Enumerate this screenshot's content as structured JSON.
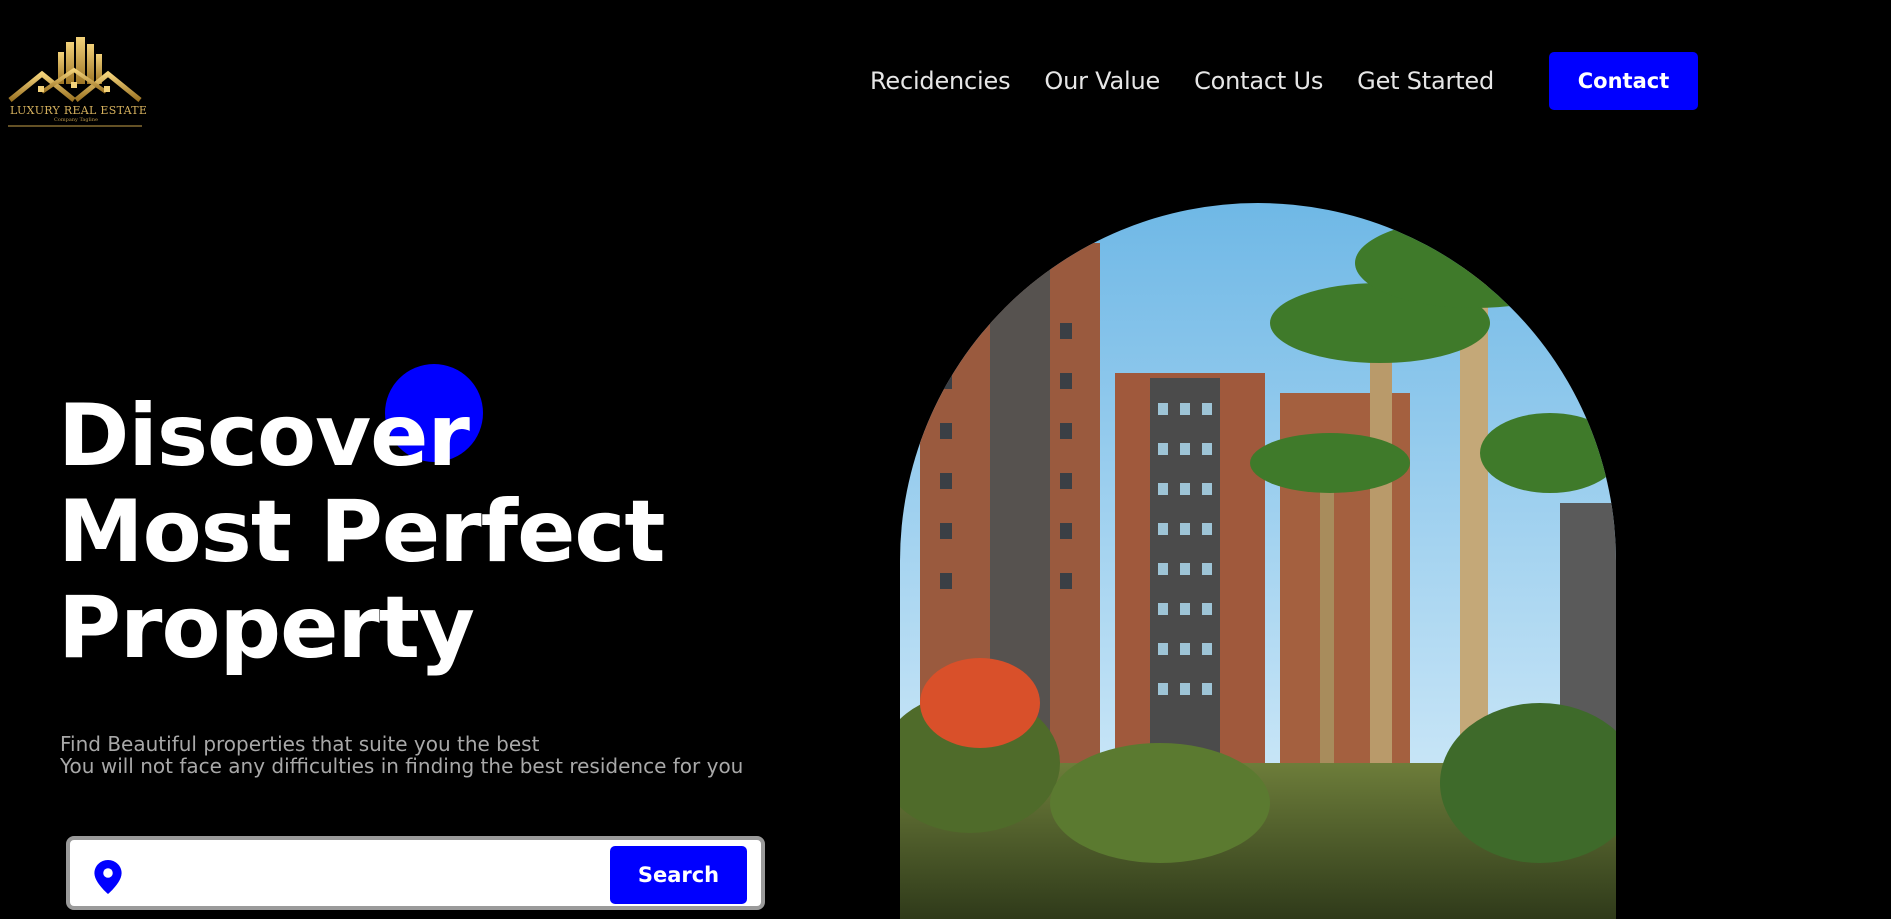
{
  "logo": {
    "brand": "LUXURY REAL ESTATE",
    "tagline": "Company Tagline",
    "gold": "#c9a24a"
  },
  "nav": {
    "links": [
      "Recidencies",
      "Our Value",
      "Contact Us",
      "Get Started"
    ],
    "contact_button": "Contact"
  },
  "hero": {
    "headline": [
      "Discover",
      "Most Perfect",
      "Property"
    ],
    "subtext": [
      "Find Beautiful properties that suite you the best",
      "You will not face any difficulties in finding the best residence for you"
    ],
    "accent_color": "#0000ff"
  },
  "search": {
    "placeholder": "",
    "button_label": "Search",
    "icon": "location-pin-icon"
  },
  "image": {
    "subject": "residential-towers-with-palm-trees"
  }
}
